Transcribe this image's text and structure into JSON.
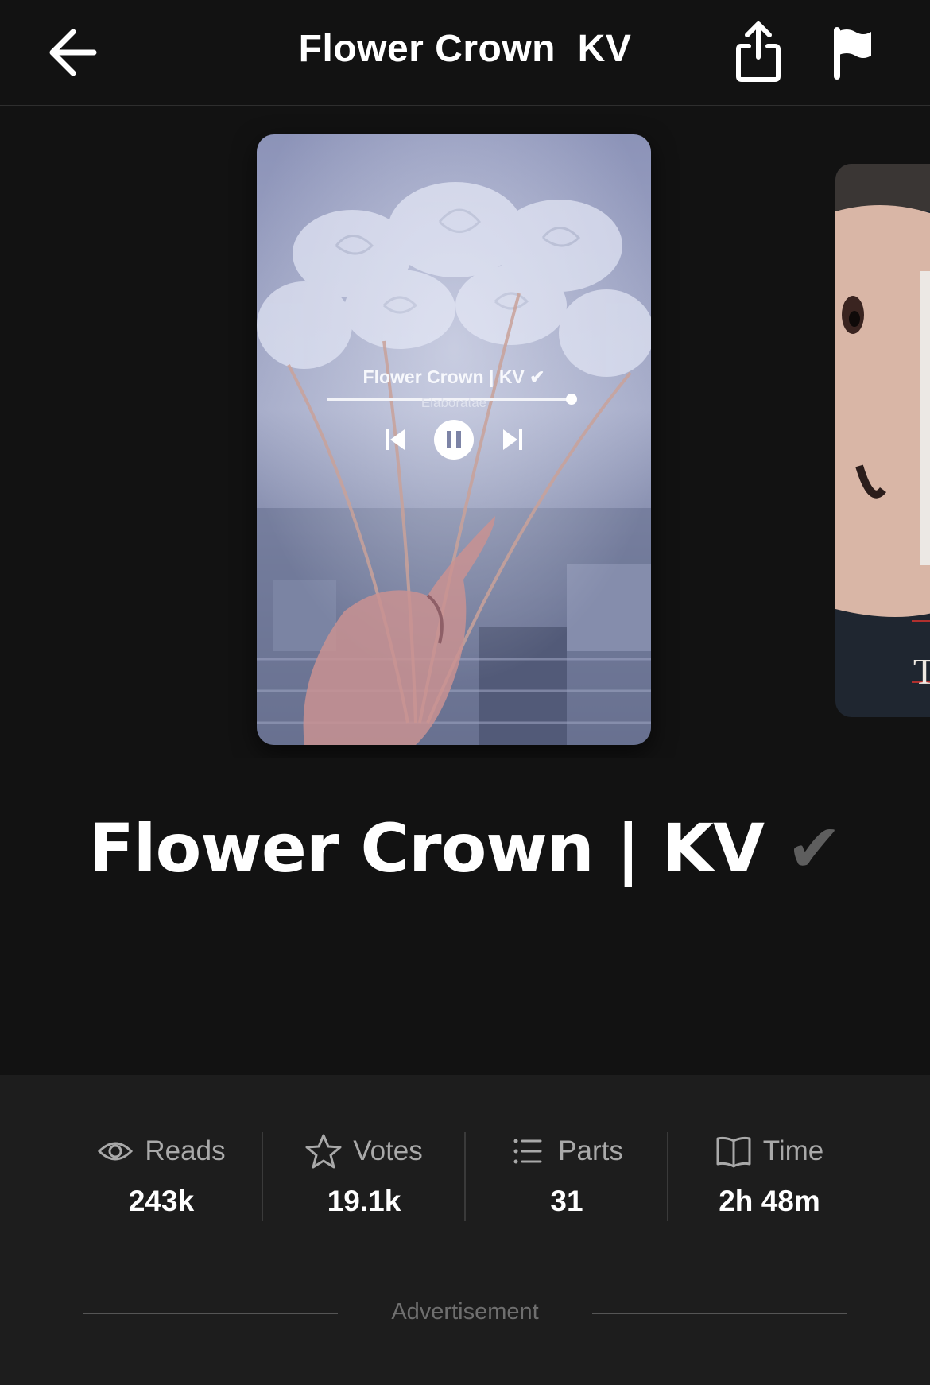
{
  "header": {
    "title": "Flower Crown  KV",
    "back_icon": "arrow-left-icon",
    "share_icon": "share-icon",
    "report_icon": "flag-icon"
  },
  "cover": {
    "song_title": "Flower Crown | KV ✔",
    "artist": "Elaboratae",
    "player_progress": 0.8,
    "player_icons": [
      "skip-back-icon",
      "pause-icon",
      "skip-forward-icon"
    ],
    "next_cover_letter": "T"
  },
  "story": {
    "title": "Flower Crown | KV",
    "title_check": "✔"
  },
  "stats": [
    {
      "icon": "eye-icon",
      "label": "Reads",
      "value": "243k"
    },
    {
      "icon": "star-icon",
      "label": "Votes",
      "value": "19.1k"
    },
    {
      "icon": "list-icon",
      "label": "Parts",
      "value": "31"
    },
    {
      "icon": "book-icon",
      "label": "Time",
      "value": "2h 48m"
    }
  ],
  "advertisement_label": "Advertisement",
  "colors": {
    "background": "#121212",
    "panel": "#1d1d1d",
    "muted_text": "#a9a9a9"
  }
}
